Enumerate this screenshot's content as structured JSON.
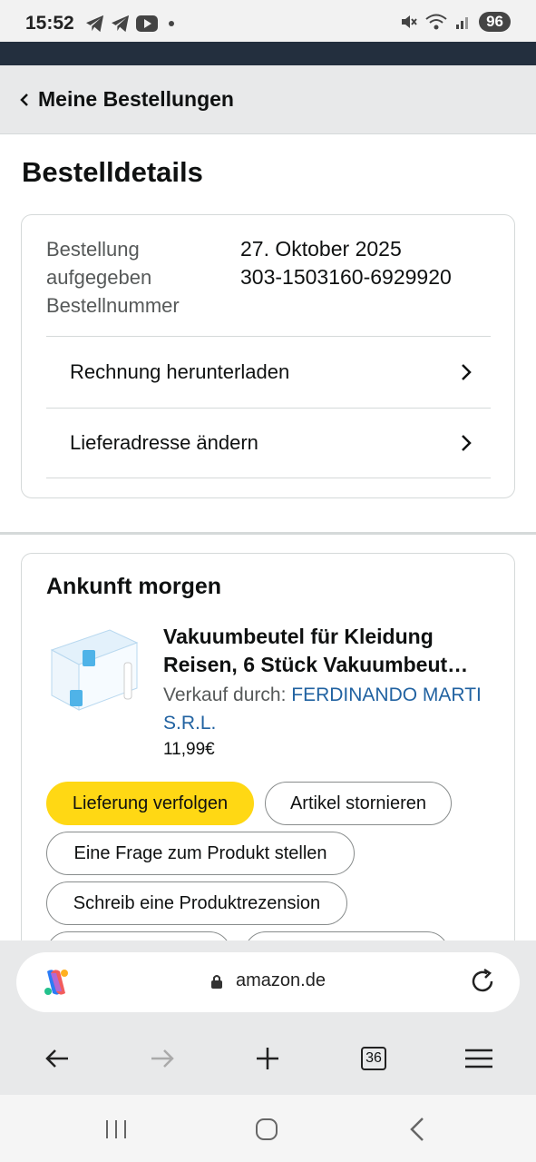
{
  "status_bar": {
    "time": "15:52",
    "battery": "96",
    "left_icons": [
      "telegram-icon",
      "telegram-icon",
      "youtube-icon",
      "dot-icon"
    ],
    "right_icons": [
      "mute-icon",
      "wifi-icon",
      "signal-icon"
    ]
  },
  "header": {
    "back_label": "Meine Bestellungen"
  },
  "page": {
    "title": "Bestelldetails"
  },
  "order_info": {
    "labels": [
      "Bestellung aufgegeben",
      "Bestellnummer"
    ],
    "label_line1": "Bestellung",
    "label_line2": "aufgegeben",
    "label_line3": "Bestellnummer",
    "order_date": "27. Oktober 2025",
    "order_number": "303-1503160-6929920"
  },
  "actions": {
    "download_invoice": "Rechnung herunterladen",
    "change_address": "Lieferadresse ändern"
  },
  "shipment": {
    "arrival": "Ankunft morgen",
    "product_title": "Vakuumbeutel für Kleidung Reisen, 6 Stück Vakuumbeut…",
    "seller_prefix": "Verkauf durch: ",
    "seller_name": "FERDINANDO MARTI S.R.L.",
    "price": "11,99€",
    "buttons": {
      "track": "Lieferung verfolgen",
      "cancel": "Artikel stornieren",
      "ask": "Eine Frage zum Produkt stellen",
      "review": "Schreib eine Produktrezension"
    }
  },
  "browser": {
    "url": "amazon.de",
    "tab_count": "36"
  },
  "colors": {
    "primary_button": "#ffd814",
    "link": "#2162a1",
    "header_dark": "#232f3e"
  }
}
